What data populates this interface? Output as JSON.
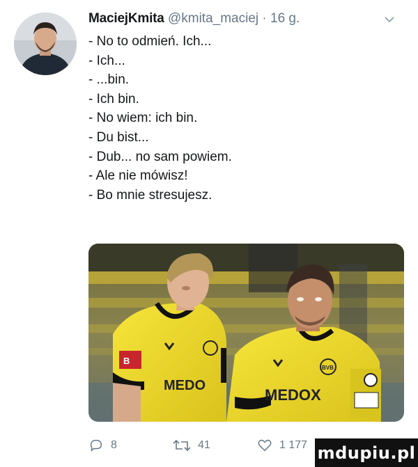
{
  "tweet": {
    "author": {
      "display_name": "MaciejKmita",
      "handle": "@kmita_maciej",
      "separator": "·",
      "time": "16 g."
    },
    "avatar_icon": "user-avatar",
    "menu_icon": "chevron-down-icon",
    "lines": [
      "- No to odmień. Ich...",
      "- Ich...",
      "- ...bin.",
      "- Ich bin.",
      "- No wiem: ich bin.",
      "- Du bist...",
      "- Dub... no sam powiem.",
      "- Ale nie mówisz!",
      "- Bo mnie stresujesz."
    ],
    "media": {
      "shirt_color": "#f3e02a",
      "sponsor_left": "MEDO",
      "sponsor_right": "MEDOX",
      "club_badge": "BVB"
    },
    "actions": {
      "reply_count": "8",
      "retweet_count": "41",
      "like_count": "1 177",
      "reply_icon": "reply-icon",
      "retweet_icon": "retweet-icon",
      "like_icon": "heart-icon",
      "share_icon": "share-icon"
    }
  },
  "watermark": "mdupiu.pl",
  "colors": {
    "text": "#14171a",
    "muted": "#657786",
    "accent_yellow": "#f3e02a"
  }
}
